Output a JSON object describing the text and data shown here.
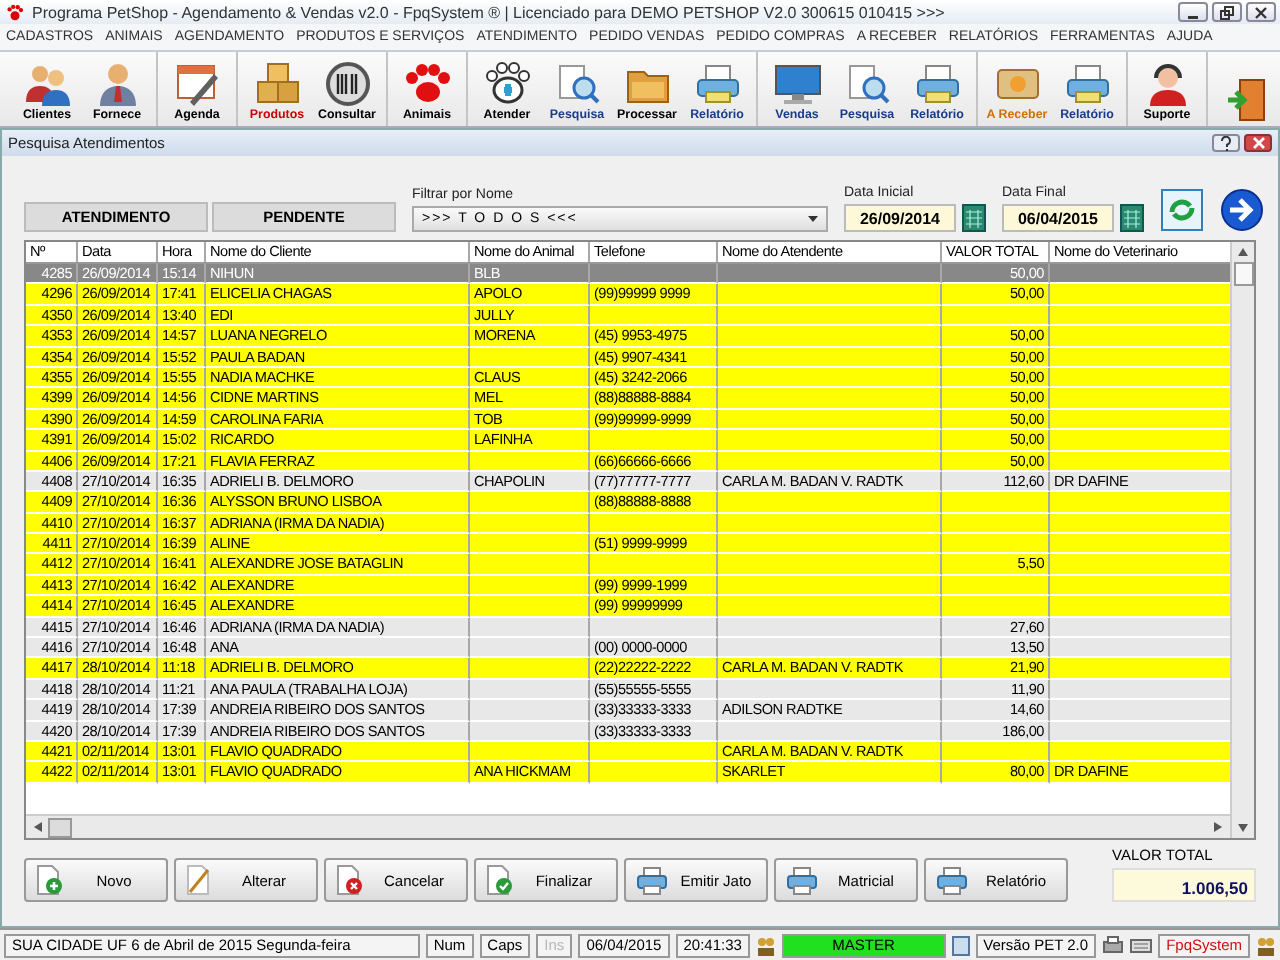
{
  "window": {
    "title": "Programa PetShop - Agendamento & Vendas v2.0 - FpqSystem ® | Licenciado para  DEMO PETSHOP V2.0 300615 010415 >>>"
  },
  "menu": [
    "CADASTROS",
    "ANIMAIS",
    "AGENDAMENTO",
    "PRODUTOS E SERVIÇOS",
    "ATENDIMENTO",
    "PEDIDO VENDAS",
    "PEDIDO COMPRAS",
    "A RECEBER",
    "RELATÓRIOS",
    "FERRAMENTAS",
    "AJUDA"
  ],
  "toolbar": [
    {
      "items": [
        {
          "label": "Clientes",
          "kind": "people",
          "color": "#000000"
        },
        {
          "label": "Fornece",
          "kind": "person",
          "color": "#000000"
        }
      ]
    },
    {
      "items": [
        {
          "label": "Agenda",
          "kind": "calendar",
          "color": "#000000"
        }
      ]
    },
    {
      "items": [
        {
          "label": "Produtos",
          "kind": "boxes",
          "color": "#cc0000"
        },
        {
          "label": "Consultar",
          "kind": "barcode",
          "color": "#000000"
        }
      ]
    },
    {
      "items": [
        {
          "label": "Animais",
          "kind": "paw",
          "color": "#000000"
        }
      ]
    },
    {
      "items": [
        {
          "label": "Atender",
          "kind": "pawplus",
          "color": "#000000"
        },
        {
          "label": "Pesquisa",
          "kind": "magnifier",
          "color": "#1a3a8a"
        },
        {
          "label": "Processar",
          "kind": "folder",
          "color": "#000000"
        },
        {
          "label": "Relatório",
          "kind": "printer",
          "color": "#1a3a8a"
        }
      ]
    },
    {
      "items": [
        {
          "label": "Vendas",
          "kind": "monitor",
          "color": "#1a3a8a"
        },
        {
          "label": "Pesquisa",
          "kind": "magnifier",
          "color": "#1a3a8a"
        },
        {
          "label": "Relatório",
          "kind": "printer",
          "color": "#1a3a8a"
        }
      ]
    },
    {
      "items": [
        {
          "label": "A Receber",
          "kind": "money",
          "color": "#d07000"
        },
        {
          "label": "Relatório",
          "kind": "printer",
          "color": "#1a3a8a"
        }
      ]
    },
    {
      "items": [
        {
          "label": "Suporte",
          "kind": "headset",
          "color": "#000000"
        }
      ]
    },
    {
      "items": [
        {
          "kind": "door"
        }
      ]
    }
  ],
  "subwindow": {
    "title": "Pesquisa Atendimentos"
  },
  "legend": [
    "ATENDIMENTO",
    "PENDENTE"
  ],
  "name_filter": {
    "label": "Filtrar por Nome",
    "value": ">>> T O D O S <<<"
  },
  "start_date": {
    "label": "Data Inicial",
    "value": "26/09/2014"
  },
  "end_date": {
    "label": "Data Final",
    "value": "06/04/2015"
  },
  "table": {
    "columns": [
      "Nº",
      "Data",
      "Hora",
      "Nome do Cliente",
      "Nome do Animal",
      "Telefone",
      "Nome do Atendente",
      "VALOR TOTAL",
      "Nome do Veterinario"
    ],
    "rows": [
      {
        "selected": true,
        "highlighted": false,
        "cells": [
          "4285",
          "26/09/2014",
          "15:14",
          "NIHUN",
          "BLB",
          "",
          "",
          "50,00",
          ""
        ]
      },
      {
        "selected": false,
        "highlighted": true,
        "cells": [
          "4296",
          "26/09/2014",
          "17:41",
          "ELICELIA CHAGAS",
          "APOLO",
          "(99)99999 9999",
          "",
          "50,00",
          ""
        ]
      },
      {
        "selected": false,
        "highlighted": true,
        "cells": [
          "4350",
          "26/09/2014",
          "13:40",
          "EDI",
          "JULLY",
          "",
          "",
          "",
          ""
        ]
      },
      {
        "selected": false,
        "highlighted": true,
        "cells": [
          "4353",
          "26/09/2014",
          "14:57",
          "LUANA NEGRELO",
          "MORENA",
          "(45) 9953-4975",
          "",
          "50,00",
          ""
        ]
      },
      {
        "selected": false,
        "highlighted": true,
        "cells": [
          "4354",
          "26/09/2014",
          "15:52",
          "PAULA BADAN",
          "",
          "(45) 9907-4341",
          "",
          "50,00",
          ""
        ]
      },
      {
        "selected": false,
        "highlighted": true,
        "cells": [
          "4355",
          "26/09/2014",
          "15:55",
          "NADIA MACHKE",
          "CLAUS",
          "(45) 3242-2066",
          "",
          "50,00",
          ""
        ]
      },
      {
        "selected": false,
        "highlighted": true,
        "cells": [
          "4399",
          "26/09/2014",
          "14:56",
          "CIDNE MARTINS",
          "MEL",
          "(88)88888-8884",
          "",
          "50,00",
          ""
        ]
      },
      {
        "selected": false,
        "highlighted": true,
        "cells": [
          "4390",
          "26/09/2014",
          "14:59",
          "CAROLINA FARIA",
          "TOB",
          "(99)99999-9999",
          "",
          "50,00",
          ""
        ]
      },
      {
        "selected": false,
        "highlighted": true,
        "cells": [
          "4391",
          "26/09/2014",
          "15:02",
          "RICARDO",
          "LAFINHA",
          "",
          "",
          "50,00",
          ""
        ]
      },
      {
        "selected": false,
        "highlighted": true,
        "cells": [
          "4406",
          "26/09/2014",
          "17:21",
          "FLAVIA FERRAZ",
          "",
          "(66)66666-6666",
          "",
          "50,00",
          ""
        ]
      },
      {
        "selected": false,
        "highlighted": false,
        "cells": [
          "4408",
          "27/10/2014",
          "16:35",
          "ADRIELI B. DELMORO",
          "CHAPOLIN",
          "(77)77777-7777",
          "CARLA M. BADAN V. RADTK",
          "112,60",
          "DR DAFINE"
        ]
      },
      {
        "selected": false,
        "highlighted": true,
        "cells": [
          "4409",
          "27/10/2014",
          "16:36",
          "ALYSSON BRUNO LISBOA",
          "",
          "(88)88888-8888",
          "",
          "",
          ""
        ]
      },
      {
        "selected": false,
        "highlighted": true,
        "cells": [
          "4410",
          "27/10/2014",
          "16:37",
          "ADRIANA (IRMA DA NADIA)",
          "",
          "",
          "",
          "",
          ""
        ]
      },
      {
        "selected": false,
        "highlighted": true,
        "cells": [
          "4411",
          "27/10/2014",
          "16:39",
          "ALINE",
          "",
          "(51) 9999-9999",
          "",
          "",
          ""
        ]
      },
      {
        "selected": false,
        "highlighted": true,
        "cells": [
          "4412",
          "27/10/2014",
          "16:41",
          "ALEXANDRE JOSE BATAGLIN",
          "",
          "",
          "",
          "5,50",
          ""
        ]
      },
      {
        "selected": false,
        "highlighted": true,
        "cells": [
          "4413",
          "27/10/2014",
          "16:42",
          "ALEXANDRE",
          "",
          "(99) 9999-1999",
          "",
          "",
          ""
        ]
      },
      {
        "selected": false,
        "highlighted": true,
        "cells": [
          "4414",
          "27/10/2014",
          "16:45",
          "ALEXANDRE",
          "",
          "(99) 99999999",
          "",
          "",
          ""
        ]
      },
      {
        "selected": false,
        "highlighted": false,
        "cells": [
          "4415",
          "27/10/2014",
          "16:46",
          "ADRIANA (IRMA DA NADIA)",
          "",
          "",
          "",
          "27,60",
          ""
        ]
      },
      {
        "selected": false,
        "highlighted": false,
        "cells": [
          "4416",
          "27/10/2014",
          "16:48",
          "ANA",
          "",
          "(00) 0000-0000",
          "",
          "13,50",
          ""
        ]
      },
      {
        "selected": false,
        "highlighted": true,
        "cells": [
          "4417",
          "28/10/2014",
          "11:18",
          "ADRIELI B. DELMORO",
          "",
          "(22)22222-2222",
          "CARLA M. BADAN V. RADTK",
          "21,90",
          ""
        ]
      },
      {
        "selected": false,
        "highlighted": false,
        "cells": [
          "4418",
          "28/10/2014",
          "11:21",
          "ANA PAULA (TRABALHA LOJA)",
          "",
          "(55)55555-5555",
          "",
          "11,90",
          ""
        ]
      },
      {
        "selected": false,
        "highlighted": false,
        "cells": [
          "4419",
          "28/10/2014",
          "17:39",
          "ANDREIA RIBEIRO DOS SANTOS",
          "",
          "(33)33333-3333",
          "ADILSON RADTKE",
          "14,60",
          ""
        ]
      },
      {
        "selected": false,
        "highlighted": false,
        "cells": [
          "4420",
          "28/10/2014",
          "17:39",
          "ANDREIA RIBEIRO DOS SANTOS",
          "",
          "(33)33333-3333",
          "",
          "186,00",
          ""
        ]
      },
      {
        "selected": false,
        "highlighted": true,
        "cells": [
          "4421",
          "02/11/2014",
          "13:01",
          "FLAVIO QUADRADO",
          "",
          "",
          "CARLA M. BADAN V. RADTK",
          "",
          ""
        ]
      },
      {
        "selected": false,
        "highlighted": true,
        "cells": [
          "4422",
          "02/11/2014",
          "13:01",
          "FLAVIO QUADRADO",
          "ANA HICKMAM",
          "",
          "SKARLET",
          "80,00",
          "DR DAFINE"
        ]
      }
    ]
  },
  "buttons": [
    {
      "label": "Novo",
      "kind": "new"
    },
    {
      "label": "Alterar",
      "kind": "edit"
    },
    {
      "label": "Cancelar",
      "kind": "cancel"
    },
    {
      "label": "Finalizar",
      "kind": "finish"
    },
    {
      "label": "Emitir Jato",
      "kind": "printer"
    },
    {
      "label": "Matricial",
      "kind": "printer"
    },
    {
      "label": "Relatório",
      "kind": "printer"
    }
  ],
  "total": {
    "label": "VALOR TOTAL",
    "value": "1.006,50"
  },
  "status_bar": {
    "location": "SUA CIDADE   UF  6 de Abril de 2015   Segunda-feira",
    "keys": [
      {
        "label": "Num",
        "on": true
      },
      {
        "label": "Caps",
        "on": true
      },
      {
        "label": "Ins",
        "on": false
      }
    ],
    "date": "06/04/2015",
    "time": "20:41:33",
    "user": "MASTER",
    "version": "Versão PET 2.0",
    "brand": "FpqSystem"
  }
}
